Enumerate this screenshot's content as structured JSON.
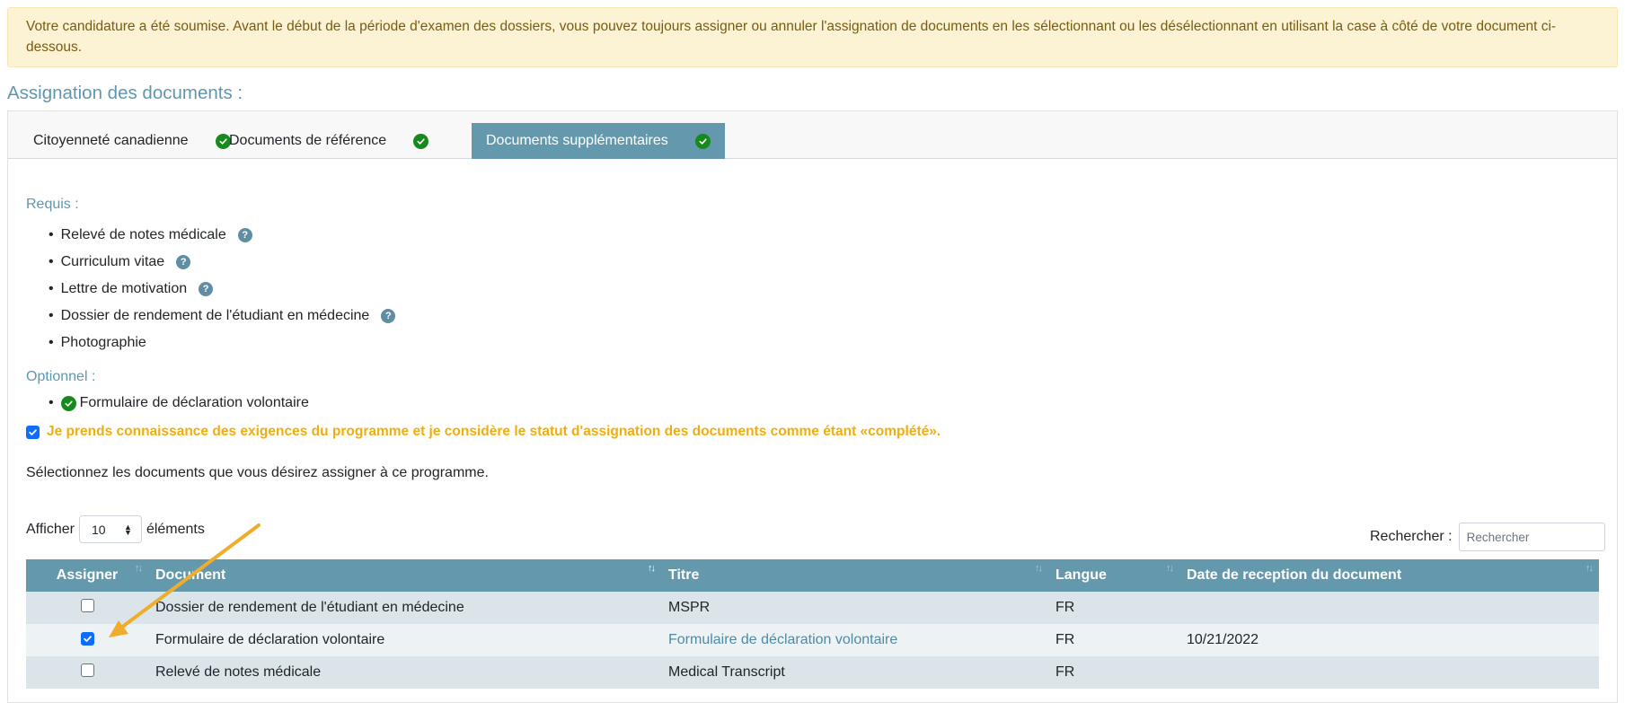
{
  "alert": {
    "text": "Votre candidature a été soumise. Avant le début de la période d'examen des dossiers, vous pouvez toujours assigner ou annuler l'assignation de documents en les sélectionnant ou les désélectionnant en utilisant la case à côté de votre document ci-dessous."
  },
  "section_title": "Assignation des documents :",
  "tabs": [
    {
      "label": "Citoyenneté canadienne",
      "complete": true,
      "active": false
    },
    {
      "label": "Documents de référence",
      "complete": true,
      "active": false
    },
    {
      "label": "Documents supplémentaires",
      "complete": true,
      "active": true
    }
  ],
  "required": {
    "heading": "Requis :",
    "items": [
      {
        "label": "Relevé de notes médicale",
        "help": true
      },
      {
        "label": "Curriculum vitae",
        "help": true
      },
      {
        "label": "Lettre de motivation",
        "help": true
      },
      {
        "label": "Dossier de rendement de l'étudiant en médecine",
        "help": true
      },
      {
        "label": "Photographie",
        "help": false
      }
    ],
    "help_glyph": "?"
  },
  "optional": {
    "heading": "Optionnel :",
    "items": [
      {
        "label": "Formulaire de déclaration volontaire",
        "complete": true
      }
    ]
  },
  "acknowledgement": {
    "checked": true,
    "text": "Je prends connaissance des exigences du programme et je considère le statut d'assignation des documents comme étant «complété»."
  },
  "instructions": "Sélectionnez les documents que vous désirez assigner à ce programme.",
  "length_control": {
    "prefix": "Afficher",
    "value": "10",
    "suffix": "éléments"
  },
  "search": {
    "label": "Rechercher :",
    "placeholder": "Rechercher"
  },
  "table": {
    "columns": [
      {
        "label": "Assigner",
        "sort": "none"
      },
      {
        "label": "Document",
        "sort": "asc"
      },
      {
        "label": "Titre",
        "sort": "none"
      },
      {
        "label": "Langue",
        "sort": "none"
      },
      {
        "label": "Date de reception du document",
        "sort": "none"
      }
    ],
    "rows": [
      {
        "assigned": false,
        "document": "Dossier de rendement de l'étudiant en médecine",
        "title": "MSPR",
        "title_is_link": false,
        "language": "FR",
        "date": ""
      },
      {
        "assigned": true,
        "document": "Formulaire de déclaration volontaire",
        "title": "Formulaire de déclaration volontaire",
        "title_is_link": true,
        "language": "FR",
        "date": "10/21/2022"
      },
      {
        "assigned": false,
        "document": "Relevé de notes médicale",
        "title": "Medical Transcript",
        "title_is_link": false,
        "language": "FR",
        "date": ""
      }
    ]
  },
  "colors": {
    "accent": "#6499ad",
    "success": "#17891d",
    "warning_text": "#f0ad0e",
    "annotation_arrow": "#f0ad2c"
  }
}
